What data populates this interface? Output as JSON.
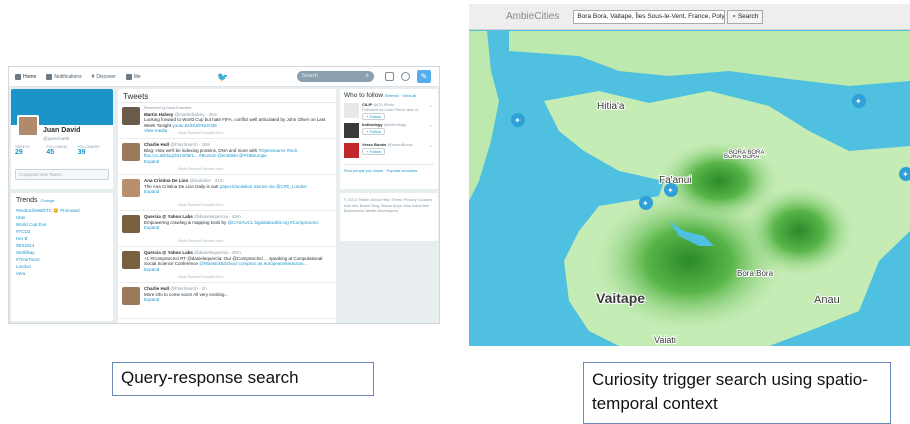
{
  "twitter": {
    "nav": {
      "home": "Home",
      "notifications": "Notifications",
      "discover": "Discover",
      "me": "Me"
    },
    "search_placeholder": "Search",
    "profile": {
      "name": "Juan David",
      "handle": "@juanvina95",
      "tweets_label": "TWEETS",
      "tweets": "29",
      "following_label": "FOLLOWING",
      "following": "45",
      "followers_label": "FOLLOWERS",
      "followers": "39",
      "compose_placeholder": "Compose new Tweet..."
    },
    "trends": {
      "title": "Trends",
      "change": "Change",
      "items": [
        "#endtoLifeWithTC 😊 Promoted",
        "Uber",
        "World Cup Eve",
        "#TCD2",
        "Her B",
        "#ES2014",
        "Sertifikay",
        "#TimeToAct",
        "London",
        "Vera"
      ]
    },
    "timeline": {
      "header": "Tweets",
      "tweets": [
        {
          "meta": "Retweeted by David Emember",
          "name": "Martin Halvey",
          "handle": "@martinhalvey · 25m",
          "text": "Looking forward to World Cup but hate FIFA, conflict well articulated by John Oliver on Last Week Tonight",
          "link": "youtu.be/DlJlDNUO39",
          "extra": "View media",
          "actions": "Reply  Retweet  Favorite  More"
        },
        {
          "meta": "",
          "name": "Charlie Hull",
          "handle": "@FlaxSearch · 16m",
          "text": "Blog: How we'll be indexing proteins, DNA and more with",
          "link": "#Opensource #Solr flax.co.uk/blog/2014/06/1... #BioSolr @emblebi @PDBeurope",
          "extra": "Expand",
          "actions": "Reply  Retweet  Favorite  More"
        },
        {
          "meta": "",
          "name": "Ana Cristina De Lion",
          "handle": "@acdelion · 21m",
          "text": "The Ana Cristina De Lion Daily is out!",
          "link": "paper.li/acdelion Stories via @CFE_London",
          "extra": "Expand",
          "actions": "Reply  Retweet  Favorite  More"
        },
        {
          "meta": "",
          "name": "Quercia @ Yahoo Labs",
          "handle": "@danielequercia · 45m",
          "text": "Empowering crawling & mapping tools by",
          "link": "@CASAUCL bigdatatoolkit.org #CompSocSci",
          "extra": "Expand",
          "actions": "Reply  Retweet  Favorite  More"
        },
        {
          "meta": "",
          "name": "Quercia @ Yahoo Labs",
          "handle": "@danielequercia · 45m",
          "text": "+1 #CompSocSci RT @danielequercia: Our @CompSocSci ... speaking at Computational Social Science Conference",
          "link": "@WarwickBSchool compsoc.wr.europeaninteraction...",
          "extra": "Expand",
          "actions": "Reply  Retweet  Favorite  More"
        },
        {
          "meta": "",
          "name": "Charlie Hull",
          "handle": "@FlaxSearch · 1h",
          "text": "More info to come soon! All very exciting...",
          "link": "",
          "extra": "Expand",
          "actions": "Reply  Retweet  Favorite  More"
        }
      ]
    },
    "who_to_follow": {
      "title": "Who to follow",
      "refresh": "Refresh · View all",
      "items": [
        {
          "name": "CILIP",
          "handle": "@CILIPinfo",
          "note": "Followed by Lush Prince and ot",
          "follow": "Follow"
        },
        {
          "name": "bottnology",
          "handle": "@bottnology",
          "note": "",
          "follow": "Follow"
        },
        {
          "name": "Verso Books",
          "handle": "@VersoBooks",
          "note": "",
          "follow": "Follow"
        }
      ],
      "find_people": "Find people you know · Popular accounts"
    },
    "footer": "© 2014 Twitter  About  Help  Terms  Privacy  Cookies  Ads info  Brand  Blog  Status  Apps  Jobs  Advertise  Businesses  Media  Developers"
  },
  "map_app": {
    "logo": "AmbieCities",
    "search_value": "Bora Bora, Vaitape, Îles Sous-le-Vent, France, Poly",
    "search_button": "Search",
    "labels": {
      "hitiaa": "Hitia'a",
      "faanui": "Fa'anui",
      "vaitape": "Vaitape",
      "anau": "Anau",
      "vaiati": "Vaiati",
      "bora_bora": "BORA BORA",
      "bora_bora_center": "Bora Bora"
    }
  },
  "captions": {
    "left": "Query-response search",
    "right": "Curiosity trigger search using spatio-temporal  context"
  },
  "colors": {
    "twitter_blue": "#55acee",
    "ocean": "#4fc0e0",
    "land": "#b8e8a8",
    "caption_border": "#6a8ab5"
  }
}
